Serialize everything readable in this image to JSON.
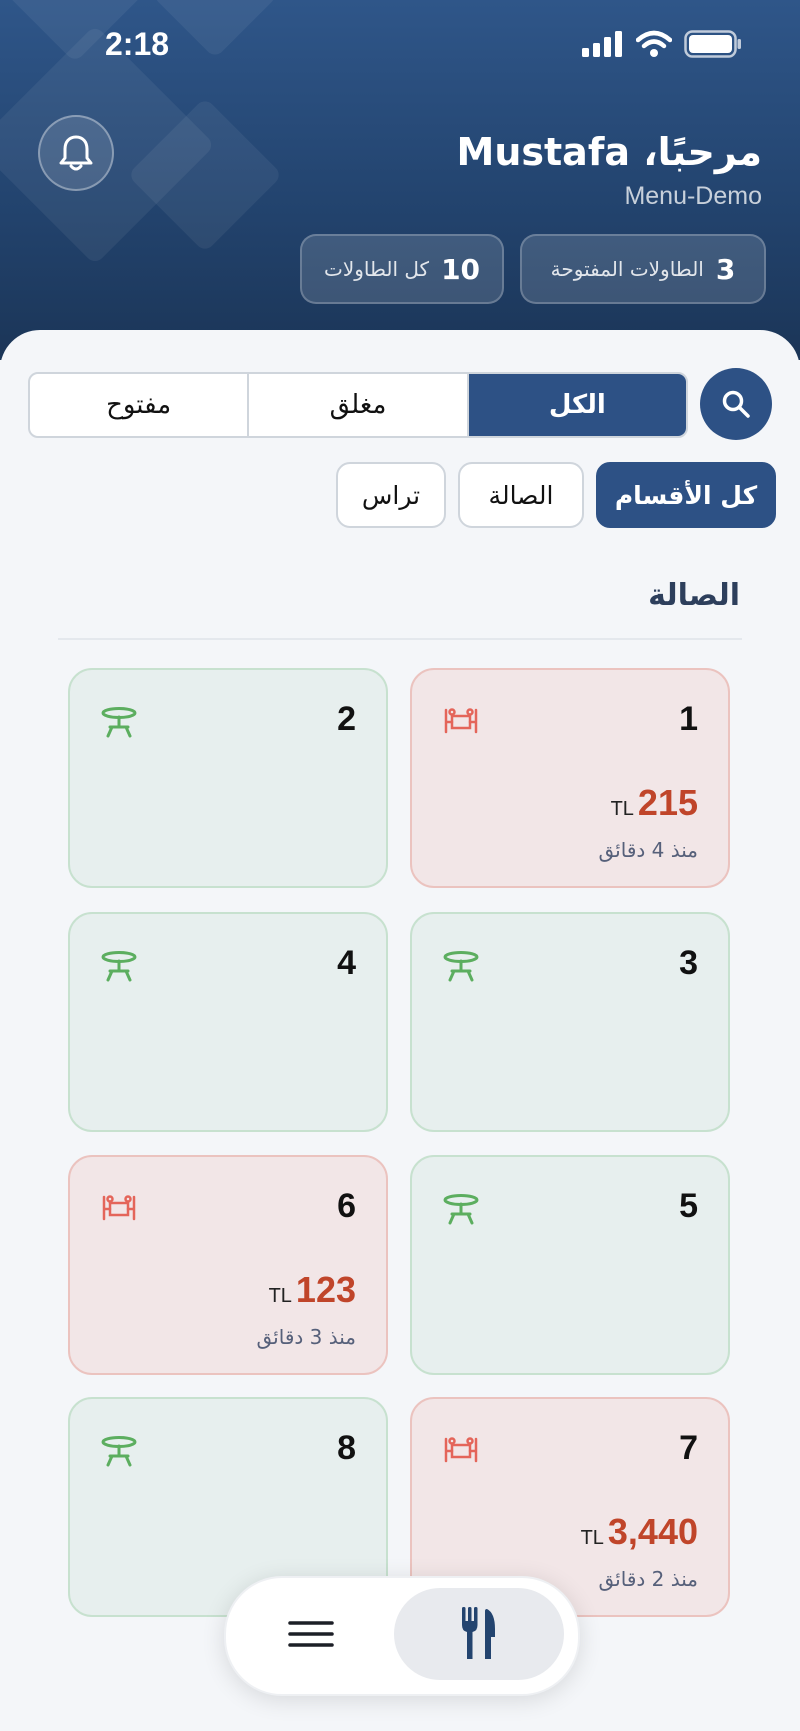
{
  "status_bar": {
    "time": "2:18"
  },
  "header": {
    "greeting": "مرحبًا، Mustafa",
    "subtitle": "Menu-Demo",
    "stats": [
      {
        "value": "3",
        "label": "الطاولات المفتوحة"
      },
      {
        "value": "10",
        "label": "كل الطاولات"
      }
    ]
  },
  "filters": {
    "status_tabs": [
      {
        "label": "الكل",
        "active": true
      },
      {
        "label": "مغلق",
        "active": false
      },
      {
        "label": "مفتوح",
        "active": false
      }
    ],
    "sections": [
      {
        "label": "كل الأقسام",
        "active": true
      },
      {
        "label": "الصالة",
        "active": false
      },
      {
        "label": "تراس",
        "active": false
      }
    ]
  },
  "section_title": "الصالة",
  "tables": [
    {
      "number": "1",
      "status": "busy",
      "amount": "215",
      "currency": "TL",
      "time": "منذ 4 دقائق"
    },
    {
      "number": "2",
      "status": "free"
    },
    {
      "number": "3",
      "status": "free"
    },
    {
      "number": "4",
      "status": "free"
    },
    {
      "number": "5",
      "status": "free"
    },
    {
      "number": "6",
      "status": "busy",
      "amount": "123",
      "currency": "TL",
      "time": "منذ 3 دقائق"
    },
    {
      "number": "7",
      "status": "busy",
      "amount": "3,440",
      "currency": "TL",
      "time": "منذ 2 دقائق"
    },
    {
      "number": "8",
      "status": "free"
    }
  ],
  "colors": {
    "header_bg": "#2a4c7c",
    "accent": "#2d5185",
    "free_icon": "#5cae5f",
    "busy_icon": "#e4655a",
    "amount": "#c0452a"
  },
  "icons": {
    "bell": "bell-icon",
    "search": "search-icon",
    "free_table": "round-table-icon",
    "busy_table": "occupied-table-icon",
    "menu": "hamburger-menu-icon",
    "tables": "fork-knife-icon"
  },
  "bottom_nav": {
    "active": "tables"
  }
}
